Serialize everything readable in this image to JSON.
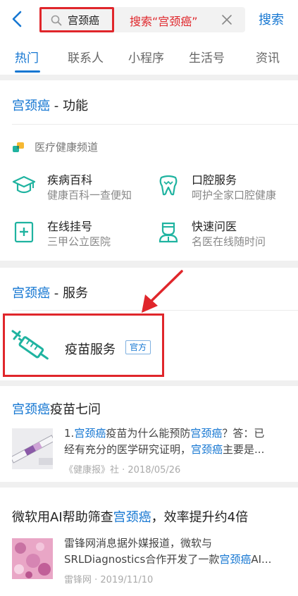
{
  "search": {
    "query": "宫颈癌",
    "annotation": "搜索“宫颈癌”",
    "submit_label": "搜索"
  },
  "tabs": [
    "热门",
    "联系人",
    "小程序",
    "生活号",
    "资讯"
  ],
  "function_section": {
    "keyword": "宫颈癌",
    "suffix": " - 功能",
    "channel_label": "医疗健康频道",
    "items": [
      {
        "icon": "graduation-cap-icon",
        "name": "疾病百科",
        "desc": "健康百科一查便知"
      },
      {
        "icon": "tooth-icon",
        "name": "口腔服务",
        "desc": "呵护全家口腔健康"
      },
      {
        "icon": "medical-clipboard-icon",
        "name": "在线挂号",
        "desc": "三甲公立医院"
      },
      {
        "icon": "doctor-icon",
        "name": "快速问医",
        "desc": "名医在线随时问"
      }
    ]
  },
  "service_section": {
    "keyword": "宫颈癌",
    "suffix": " - 服务",
    "service_name": "疫苗服务",
    "badge": "官方",
    "icon": "syringe-icon"
  },
  "articles": [
    {
      "title_keyword": "宫颈癌",
      "title_rest": "疫苗七问",
      "line1": [
        {
          "t": "1.",
          "k": false
        },
        {
          "t": "宫颈癌",
          "k": true
        },
        {
          "t": "疫苗为什么能预防",
          "k": false
        },
        {
          "t": "宫颈癌",
          "k": true
        },
        {
          "t": "？答：已",
          "k": false
        }
      ],
      "line2": [
        {
          "t": "经有充分的医学研究证明，",
          "k": false
        },
        {
          "t": "宫颈癌",
          "k": true
        },
        {
          "t": "主要是...",
          "k": false
        }
      ],
      "meta": "《健康报》社 · 2018/05/26"
    },
    {
      "title_prefix": "微软用AI帮助筛查",
      "title_keyword": "宫颈癌",
      "title_rest": "，效率提升约4倍",
      "line1": [
        {
          "t": "雷锋网消息据外媒报道，微软与",
          "k": false
        }
      ],
      "line2": [
        {
          "t": "SRLDiagnostics合作开发了一款",
          "k": false
        },
        {
          "t": "宫颈癌",
          "k": true
        },
        {
          "t": "AI...",
          "k": false
        }
      ],
      "meta": "雷锋网 · 2019/11/10"
    }
  ],
  "colors": {
    "accent": "#1677d2",
    "teal": "#1fb3a0",
    "annotation_red": "#e0262b"
  }
}
